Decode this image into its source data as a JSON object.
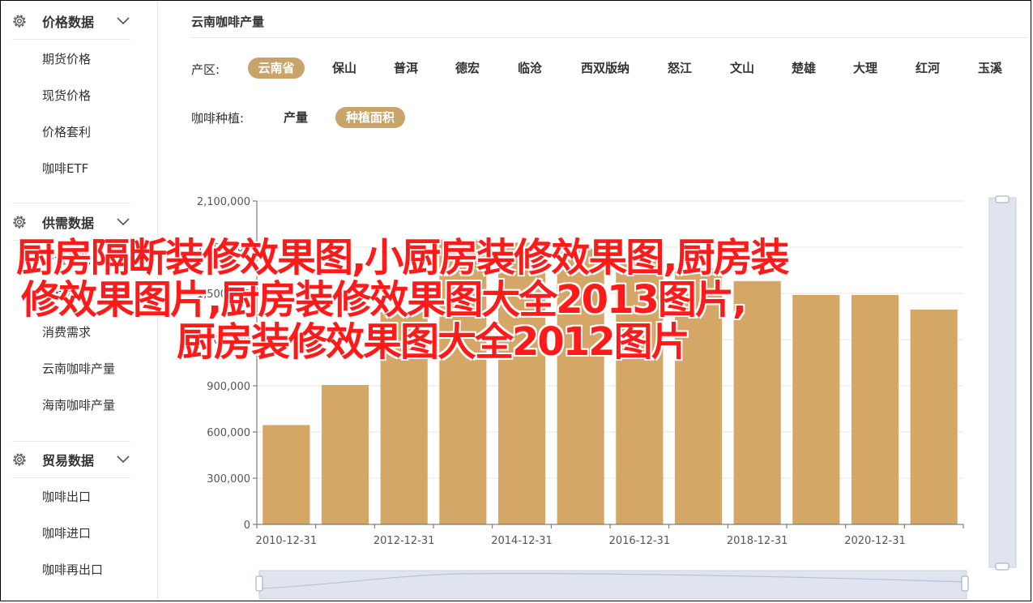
{
  "sidebar": {
    "groups": [
      {
        "title": "价格数据",
        "items": [
          "期货价格",
          "现货价格",
          "价格套利",
          "咖啡ETF"
        ]
      },
      {
        "title": "供需数据",
        "items": [
          "产量总览",
          "种植面积",
          "消费需求",
          "云南咖啡产量",
          "海南咖啡产量"
        ]
      },
      {
        "title": "贸易数据",
        "items": [
          "咖啡出口",
          "咖啡进口",
          "咖啡再出口"
        ]
      }
    ]
  },
  "main": {
    "title": "云南咖啡产量",
    "region_label": "产区:",
    "regions": [
      "云南省",
      "保山",
      "普洱",
      "德宏",
      "临沧",
      "西双版纳",
      "怒江",
      "文山",
      "楚雄",
      "大理",
      "红河",
      "玉溪"
    ],
    "region_active": "云南省",
    "type_label": "咖啡种植:",
    "types": [
      "产量",
      "种植面积"
    ],
    "type_active": "种植面积"
  },
  "colors": {
    "accent": "#c9a46a",
    "bar": "#d4a766",
    "overlay_text": "#ff1a1a",
    "slider": "#dfe4ee"
  },
  "chart_data": {
    "type": "bar",
    "categories": [
      "2010-12-31",
      "2011-12-31",
      "2012-12-31",
      "2013-12-31",
      "2014-12-31",
      "2015-12-31",
      "2016-12-31",
      "2017-12-31",
      "2018-12-31",
      "2019-12-31",
      "2020-12-31",
      "2021-12-31"
    ],
    "x_tick_labels": [
      "2010-12-31",
      "2012-12-31",
      "2014-12-31",
      "2016-12-31",
      "2018-12-31",
      "2020-12-31"
    ],
    "values": [
      645000,
      905000,
      1380000,
      1850000,
      1830000,
      1790000,
      1735000,
      1660000,
      1580000,
      1490000,
      1490000,
      1395000
    ],
    "ylim": [
      0,
      2100000
    ],
    "y_ticks": [
      "0",
      "300,000",
      "600,000",
      "900,000",
      "1,200,000",
      "1,500,000",
      "1,800,000",
      "2,100,000"
    ],
    "grid": true
  },
  "overlay": {
    "lines": [
      "厨房隔断装修效果图,小厨房装修效果图,厨房装",
      "修效果图片,厨房装修效果图大全2013图片,",
      "厨房装修效果图大全2012图片"
    ]
  }
}
